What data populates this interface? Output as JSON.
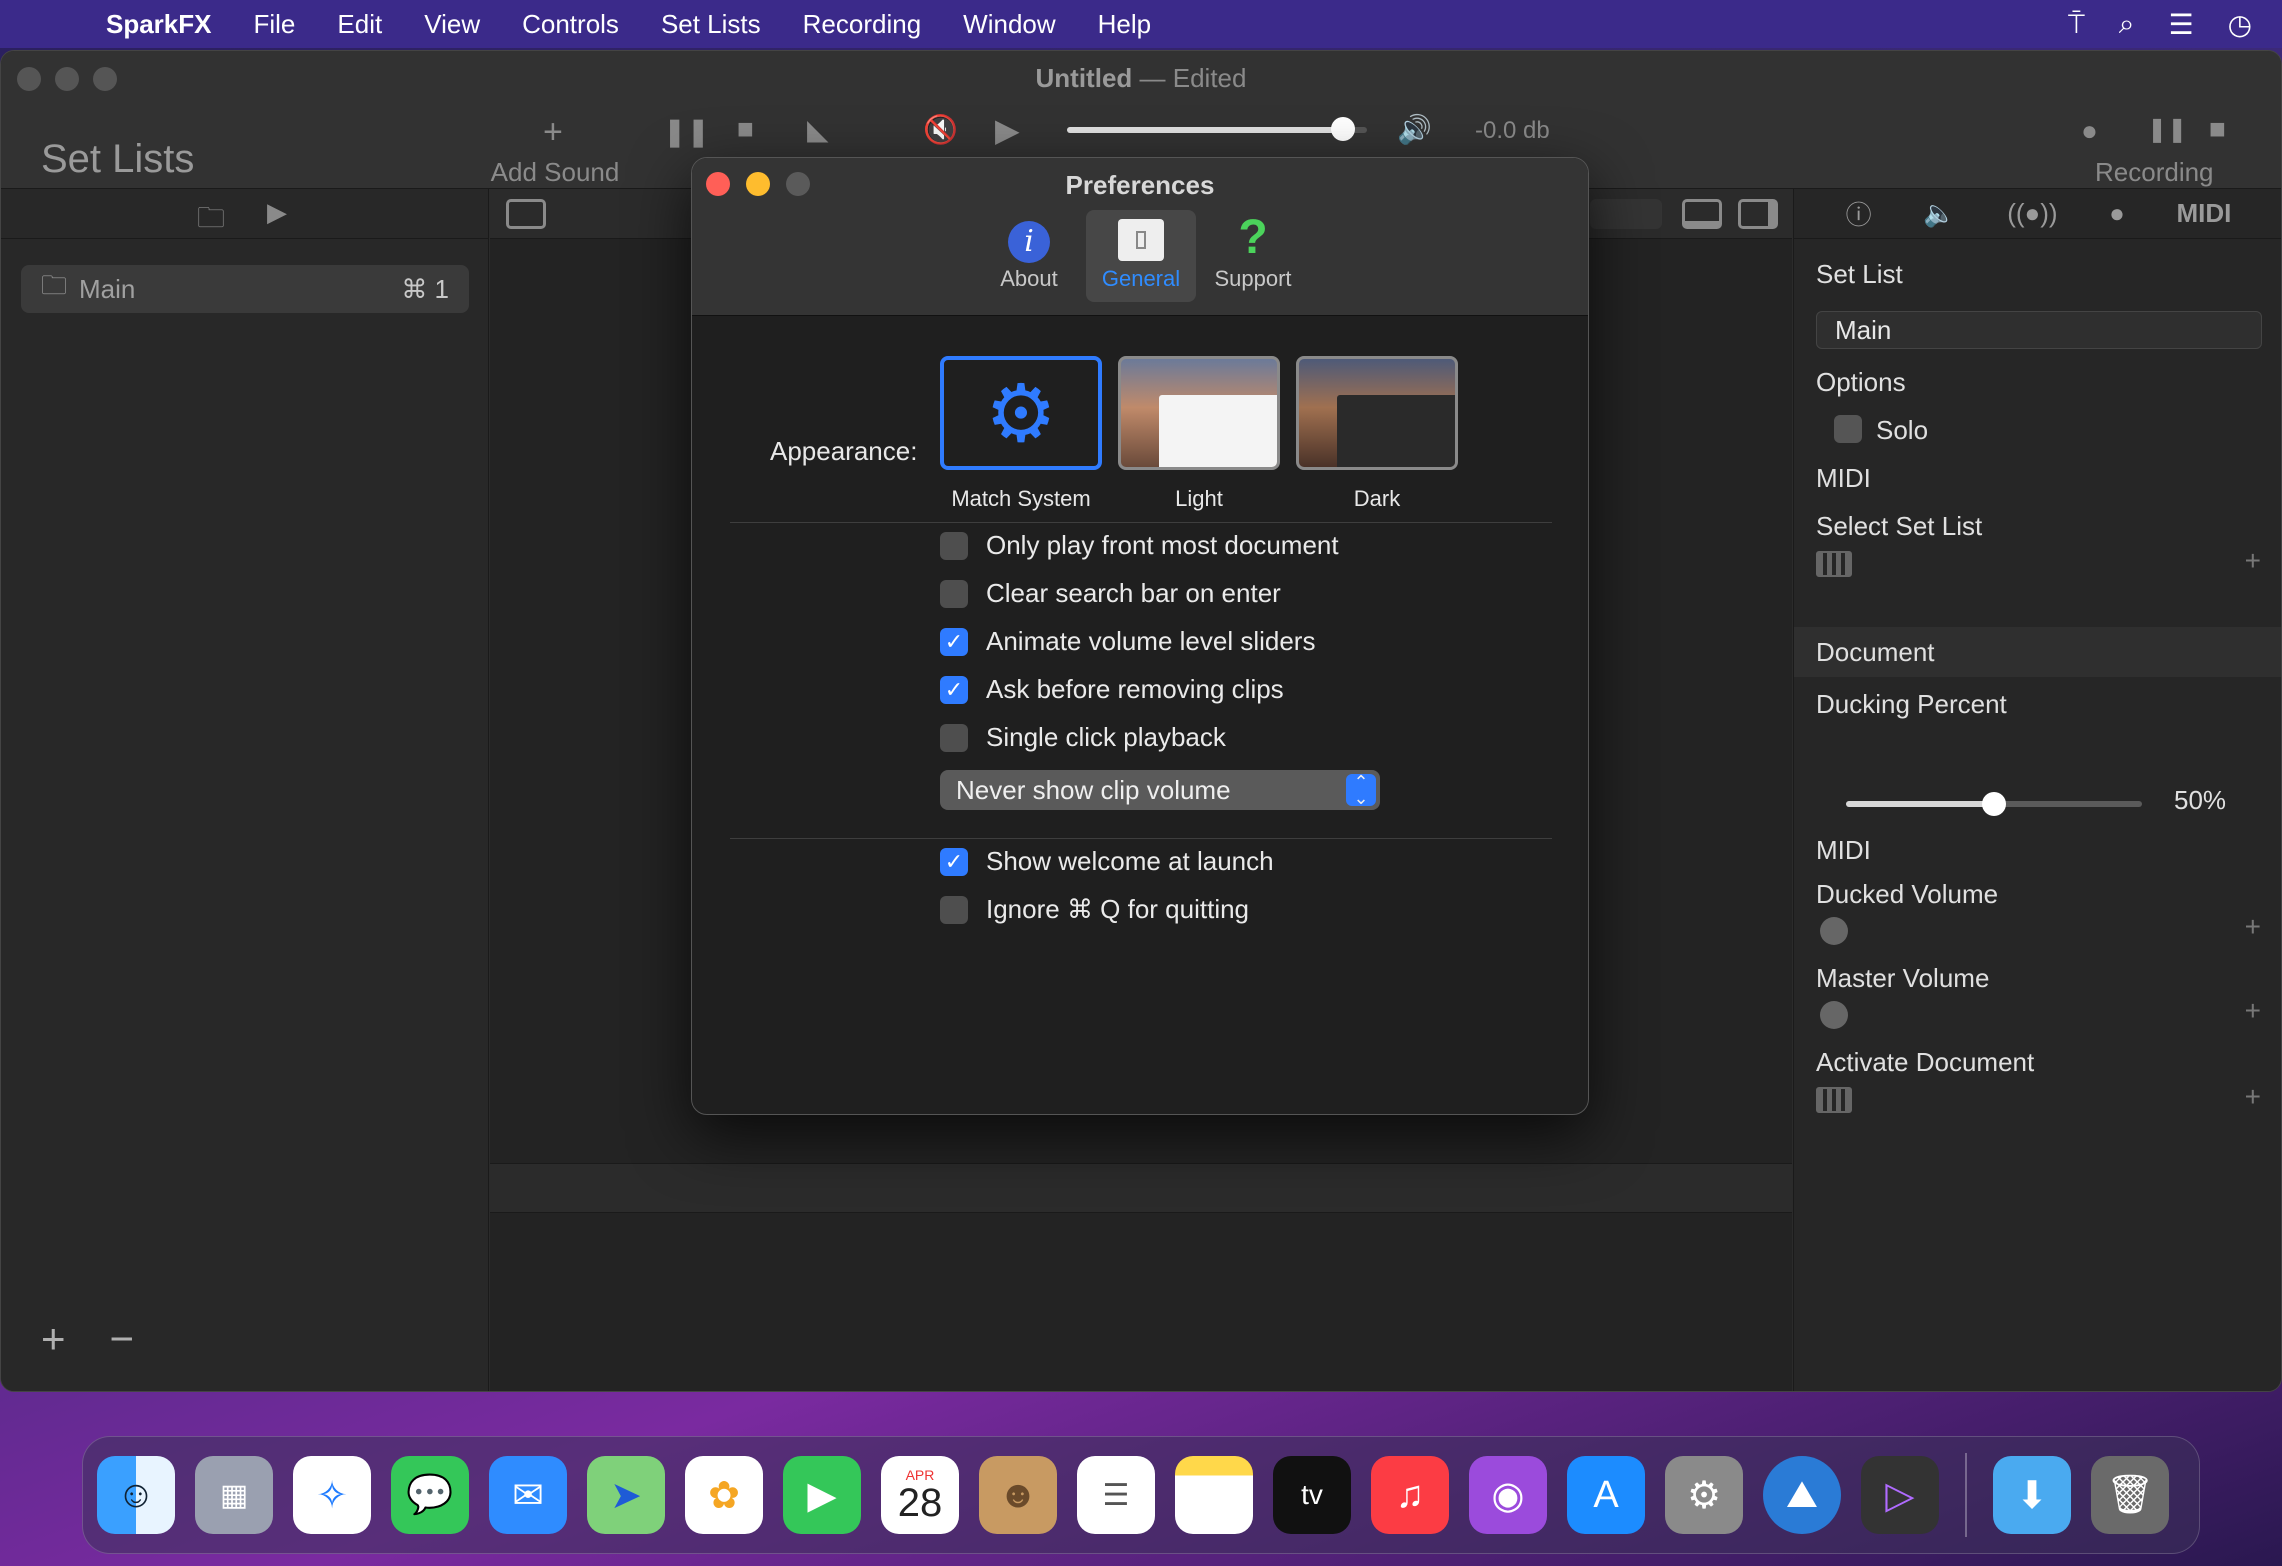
{
  "menubar": {
    "app_name": "SparkFX",
    "items": [
      "File",
      "Edit",
      "View",
      "Controls",
      "Set Lists",
      "Recording",
      "Window",
      "Help"
    ]
  },
  "window": {
    "title": "Untitled",
    "title_state": "— Edited",
    "sidebar_title": "Set Lists",
    "add_sound_label": "Add Sound",
    "volume_db": "-0.0 db",
    "recording_label": "Recording",
    "volume_level": 0.92
  },
  "sidebar": {
    "items": [
      {
        "label": "Main",
        "shortcut": "⌘ 1"
      }
    ]
  },
  "inspector": {
    "set_list_heading": "Set List",
    "set_list_value": "Main",
    "options_label": "Options",
    "solo_label": "Solo",
    "midi_label": "MIDI",
    "select_set_list_label": "Select Set List",
    "document_section": "Document",
    "ducking_percent_label": "Ducking Percent",
    "ducking_percent_value": "50%",
    "ducking_level": 0.5,
    "doc_midi_label": "MIDI",
    "ducked_volume_label": "Ducked Volume",
    "master_volume_label": "Master Volume",
    "activate_document_label": "Activate Document",
    "midi_icon_text": "MIDI"
  },
  "preferences": {
    "title": "Preferences",
    "tabs": [
      {
        "label": "About",
        "icon": "info-icon"
      },
      {
        "label": "General",
        "icon": "general-icon"
      },
      {
        "label": "Support",
        "icon": "question-icon"
      }
    ],
    "active_tab": "General",
    "appearance_label": "Appearance:",
    "appearance_options": [
      "Match System",
      "Light",
      "Dark"
    ],
    "selected_appearance": "Match System",
    "checkboxes": [
      {
        "label": "Only play front most document",
        "checked": false
      },
      {
        "label": "Clear search bar on enter",
        "checked": false
      },
      {
        "label": "Animate volume level sliders",
        "checked": true
      },
      {
        "label": "Ask before removing clips",
        "checked": true
      },
      {
        "label": "Single click playback",
        "checked": false
      }
    ],
    "clip_volume_popup": "Never show clip volume",
    "checkboxes2": [
      {
        "label": "Show welcome at launch",
        "checked": true
      },
      {
        "label": "Ignore ⌘ Q for quitting",
        "checked": false
      }
    ]
  },
  "dock": {
    "calendar_month": "APR",
    "calendar_day": "28",
    "tv_label": "tv"
  },
  "colors": {
    "accent": "#2f7bff",
    "menubar": "#3b2a8a"
  }
}
